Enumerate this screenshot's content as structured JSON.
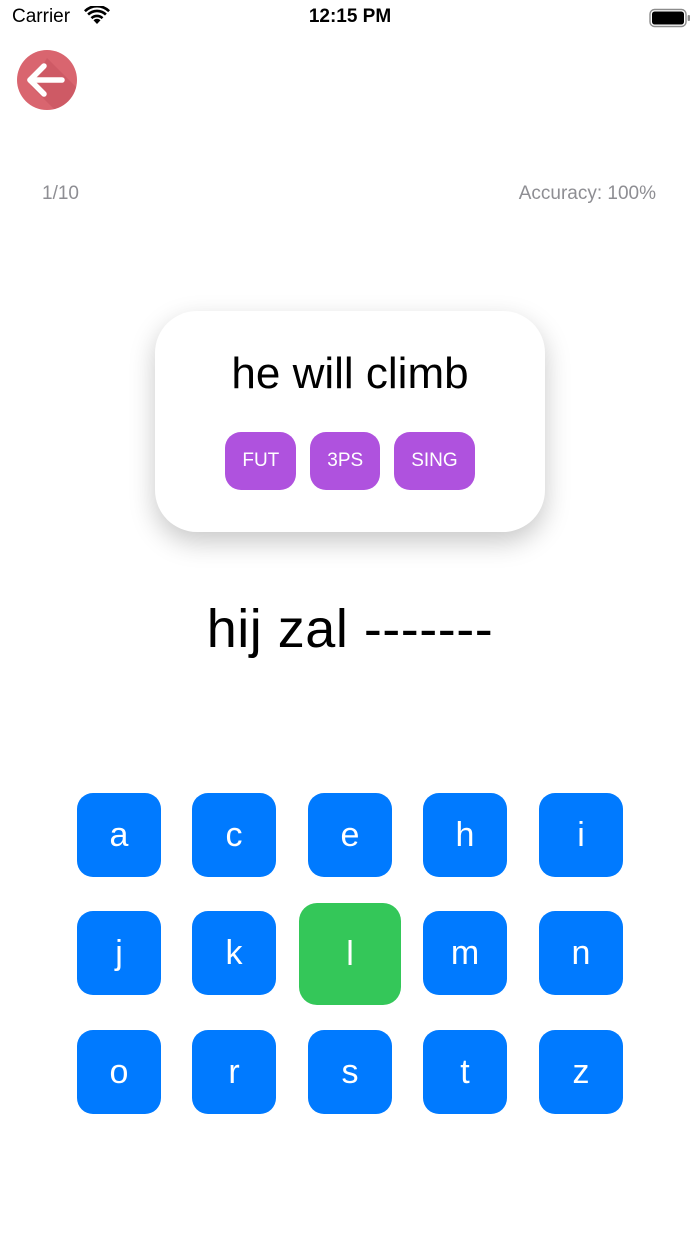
{
  "status_bar": {
    "carrier": "Carrier",
    "time": "12:15 PM"
  },
  "back_button": {
    "icon": "arrow-left-icon",
    "color": "#d9656f"
  },
  "progress": {
    "label": "1/10",
    "accuracy": "Accuracy: 100%"
  },
  "prompt": {
    "text": "he will climb",
    "tags": [
      "FUT",
      "3PS",
      "SING"
    ],
    "tag_color": "#af52de"
  },
  "answer": {
    "text": "hij zal -------"
  },
  "keyboard": {
    "key_color": "#007aff",
    "selected_color": "#34c759",
    "selected_key": "l",
    "rows": [
      [
        "a",
        "c",
        "e",
        "h",
        "i"
      ],
      [
        "j",
        "k",
        "l",
        "m",
        "n"
      ],
      [
        "o",
        "r",
        "s",
        "t",
        "z"
      ]
    ]
  }
}
